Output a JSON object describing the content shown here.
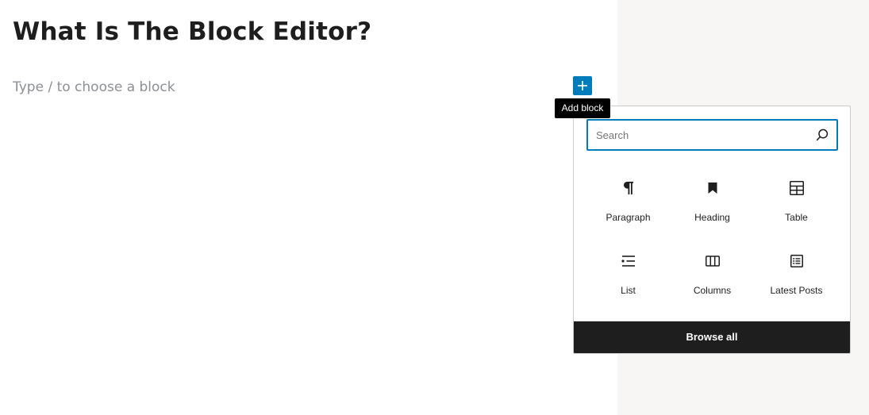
{
  "post": {
    "title": "What Is The Block Editor?",
    "placeholder": "Type / to choose a block"
  },
  "inserter": {
    "toggle_icon": "plus-icon",
    "tooltip": "Add block",
    "search": {
      "placeholder": "Search",
      "value": ""
    },
    "blocks": [
      {
        "label": "Paragraph",
        "icon": "paragraph-icon"
      },
      {
        "label": "Heading",
        "icon": "bookmark-icon"
      },
      {
        "label": "Table",
        "icon": "table-icon"
      },
      {
        "label": "List",
        "icon": "list-icon"
      },
      {
        "label": "Columns",
        "icon": "columns-icon"
      },
      {
        "label": "Latest Posts",
        "icon": "post-list-icon"
      }
    ],
    "browse_all": "Browse all"
  },
  "colors": {
    "accent": "#007cba",
    "dark": "#1e1e1e",
    "sidebar_bg": "#f7f6f4",
    "placeholder_text": "#8c8f94"
  }
}
